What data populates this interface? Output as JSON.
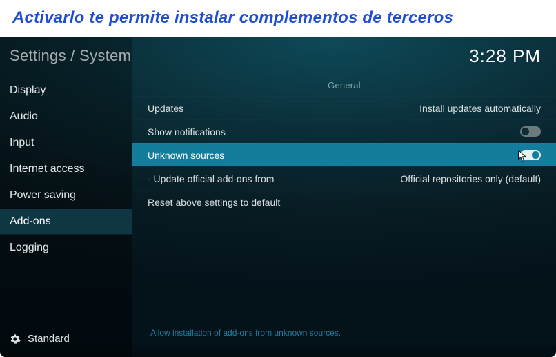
{
  "caption": "Activarlo te permite instalar complementos de terceros",
  "breadcrumb": "Settings / System",
  "clock": "3:28 PM",
  "sidebar": {
    "items": [
      {
        "label": "Display"
      },
      {
        "label": "Audio"
      },
      {
        "label": "Input"
      },
      {
        "label": "Internet access"
      },
      {
        "label": "Power saving"
      },
      {
        "label": "Add-ons"
      },
      {
        "label": "Logging"
      }
    ],
    "selected_index": 5,
    "level_label": "Standard"
  },
  "main": {
    "section_header": "General",
    "rows": [
      {
        "label": "Updates",
        "kind": "value",
        "value": "Install updates automatically"
      },
      {
        "label": "Show notifications",
        "kind": "toggle",
        "state": "off"
      },
      {
        "label": "Unknown sources",
        "kind": "toggle",
        "state": "on",
        "highlighted": true
      },
      {
        "label": "- Update official add-ons from",
        "kind": "value",
        "value": "Official repositories only (default)"
      },
      {
        "label": "Reset above settings to default",
        "kind": "action"
      }
    ],
    "footer_hint": "Allow installation of add-ons from unknown sources."
  }
}
